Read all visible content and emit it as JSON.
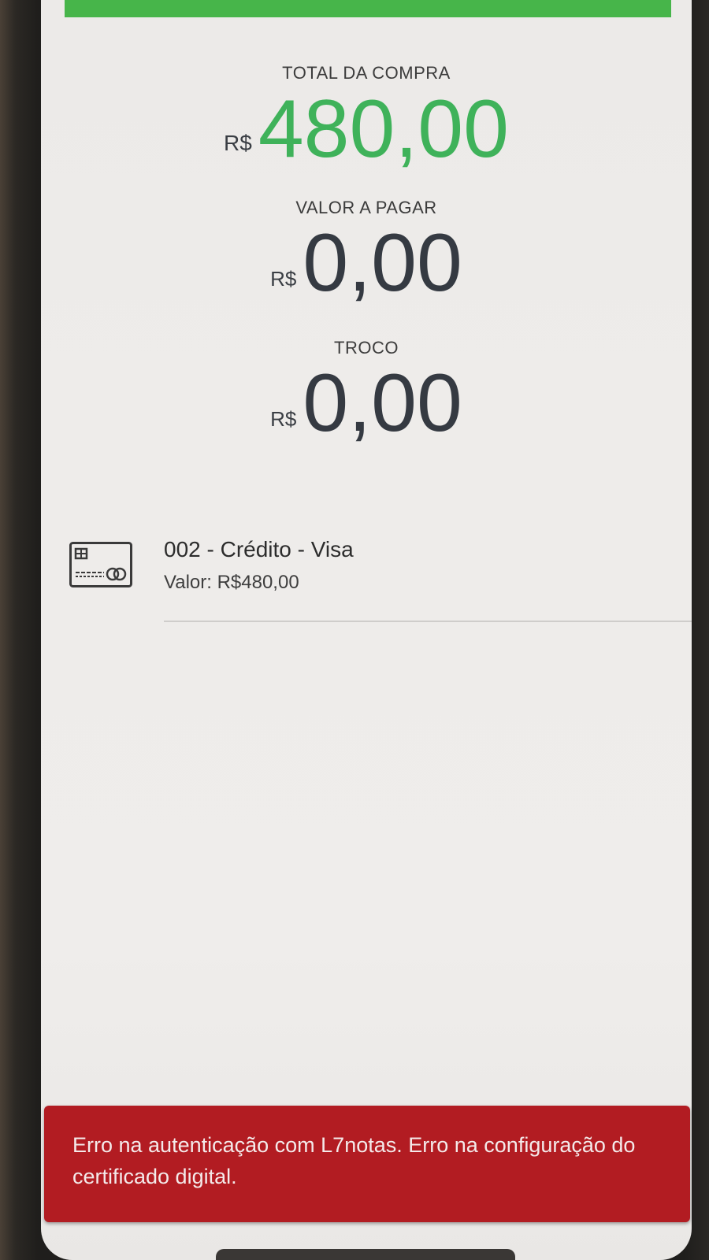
{
  "summary": {
    "total_label": "TOTAL DA COMPRA",
    "total_currency": "R$",
    "total_value": "480,00",
    "to_pay_label": "VALOR A PAGAR",
    "to_pay_currency": "R$",
    "to_pay_value": "0,00",
    "change_label": "TROCO",
    "change_currency": "R$",
    "change_value": "0,00"
  },
  "payments": [
    {
      "icon": "credit-card-icon",
      "title": "002 - Crédito - Visa",
      "value": "Valor: R$480,00"
    }
  ],
  "error": {
    "message": "Erro na autenticação com L7notas. Erro na configuração do certificado digital."
  },
  "colors": {
    "accent_green": "#47b54a",
    "amount_green": "#3fb25a",
    "error_red": "#b21c22"
  }
}
